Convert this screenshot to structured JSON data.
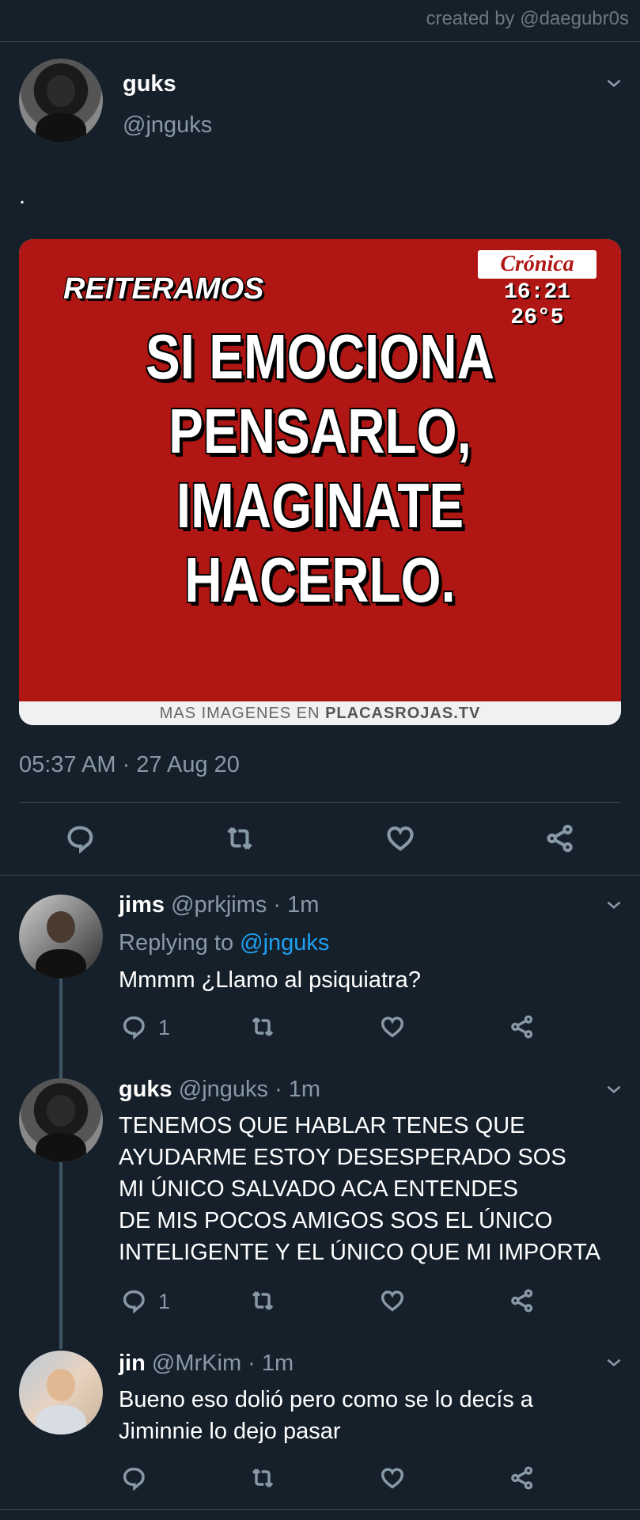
{
  "credit": "created by @daegubr0s",
  "main_tweet": {
    "name": "guks",
    "handle": "@jnguks",
    "text": ".",
    "timestamp": "05:37 AM · 27 Aug 20",
    "image": {
      "corner_label": "REITERAMOS",
      "brand": "Crónica",
      "time": "16:21",
      "temp": "26°5",
      "headline": "SI EMOCIONA\nPENSARLO,\nIMAGINATE\nHACERLO.",
      "footer_prefix": "MAS IMAGENES EN ",
      "footer_site": "PLACASROJAS.TV"
    }
  },
  "replies": [
    {
      "name": "jims",
      "meta": "@prkjims · 1m",
      "replying_label": "Replying to ",
      "replying_handle": "@jnguks",
      "text": "Mmmm ¿Llamo al psiquiatra?",
      "reply_count": "1"
    },
    {
      "name": "guks",
      "meta": "@jnguks · 1m",
      "text": "TENEMOS QUE HABLAR TENES QUE\nAYUDARME ESTOY DESESPERADO SOS\nMI ÚNICO SALVADO ACA ENTENDES\nDE MIS POCOS AMIGOS SOS EL ÚNICO\nINTELIGENTE Y EL ÚNICO QUE MI IMPORTA",
      "reply_count": "1"
    },
    {
      "name": "jin",
      "meta": "@MrKim · 1m",
      "text": "Bueno eso dolió pero como se lo decís a\nJiminnie lo dejo pasar",
      "reply_count": ""
    }
  ],
  "icons": [
    "reply-icon",
    "retweet-icon",
    "like-icon",
    "share-icon",
    "chevron-down-icon"
  ],
  "colors": {
    "background": "#15202b",
    "secondary_text": "#8899a6",
    "link": "#1da1f2",
    "divider": "#38444d"
  }
}
